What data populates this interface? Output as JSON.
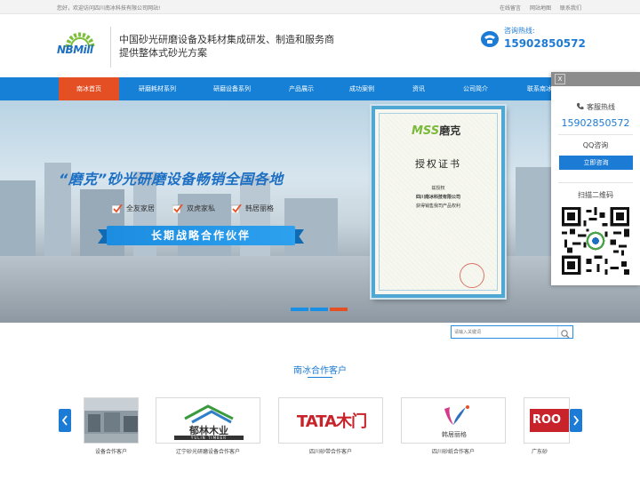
{
  "topbar": {
    "welcome": "您好，欢迎访问四川南冰科技有限公司网站!",
    "links": [
      "在线留言",
      "网站地图",
      "联系我们"
    ]
  },
  "header": {
    "logo_text": "NBMill",
    "slogan_line1": "中国砂光研磨设备及耗材集成研发、制造和服务商",
    "slogan_line2": "提供整体式砂光方案",
    "hotline_label": "咨询热线:",
    "hotline_number": "15902850572"
  },
  "nav": {
    "items": [
      "南冰首页",
      "研磨耗材系列",
      "研磨设备系列",
      "产品展示",
      "成功案例",
      "资讯",
      "公司简介",
      "联系南冰"
    ],
    "active_index": 0
  },
  "banner": {
    "title": "“磨克”砂光研磨设备畅销全国各地",
    "brands": [
      "全友家居",
      "双虎家私",
      "韩居丽格"
    ],
    "ribbon": "长期战略合作伙伴",
    "certificate": {
      "logo": "MSS",
      "logo_cn": "磨克",
      "title": "授权证书",
      "line1": "兹授权",
      "line2": "四川南冰科技有限公司",
      "line3": "获得销售我司产品权利"
    },
    "slide_count": 3,
    "active_slide": 2
  },
  "search": {
    "placeholder": "请输入关键词"
  },
  "clients": {
    "title": "南冰合作客户",
    "items": [
      {
        "caption": "设备合作客户"
      },
      {
        "caption": "辽宁砂光研磨设备合作客户",
        "logo_cn": "郁林木业",
        "logo_en": "YULIN TIMBER"
      },
      {
        "caption": "四川砂带合作客户",
        "logo": "TATA木门"
      },
      {
        "caption": "四川砂纸合作客户",
        "logo": "韩居丽格"
      },
      {
        "caption": "广东砂",
        "logo": "ROO"
      }
    ]
  },
  "float_panel": {
    "close": "X",
    "hotline_label": "客服热线",
    "hotline_number": "15902850572",
    "qq_label": "QQ咨询",
    "qq_button": "立即咨询",
    "qr_label": "扫描二维码"
  },
  "colors": {
    "primary": "#1580d6",
    "accent": "#e45024",
    "text_blue": "#1c7bd4"
  }
}
